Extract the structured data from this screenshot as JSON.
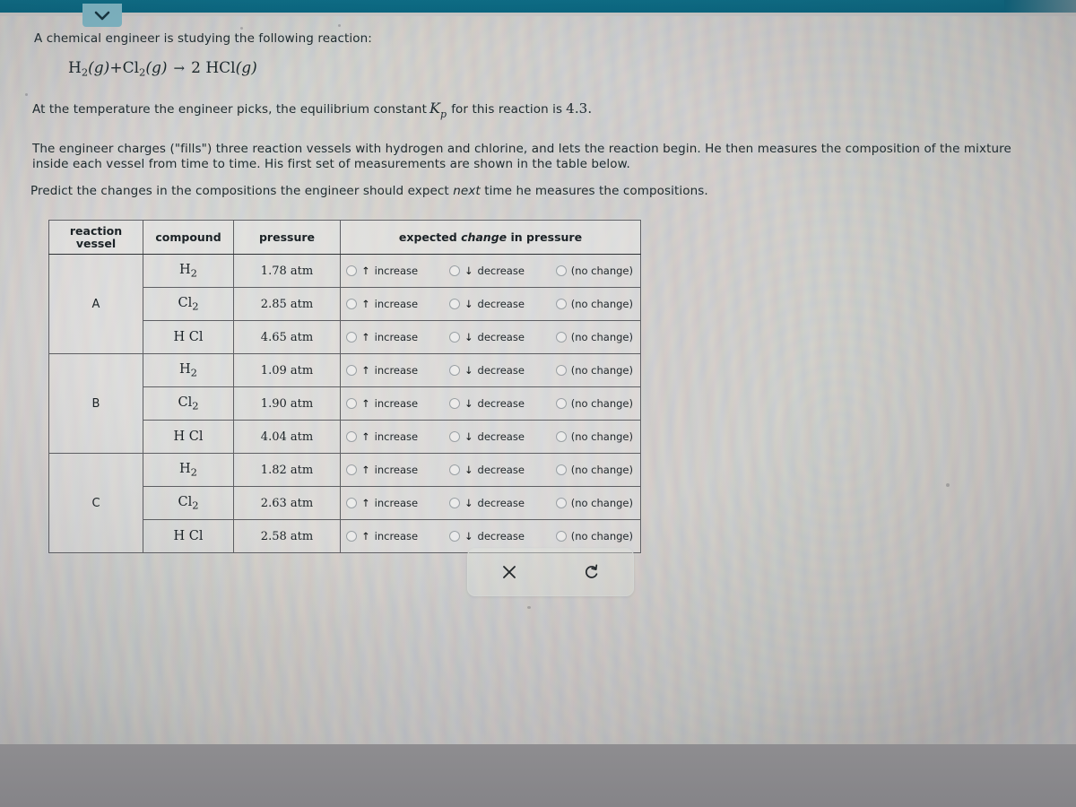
{
  "browser": {
    "tab_icon": "chevron-down-icon"
  },
  "problem": {
    "intro": "A chemical engineer is studying the following reaction:",
    "equation": {
      "reactant1": "H",
      "reactant1_sub": "2",
      "reactant1_state": "(g)",
      "plus": "+",
      "reactant2": "Cl",
      "reactant2_sub": "2",
      "reactant2_state": "(g)",
      "arrow": "→",
      "coefficient": "2",
      "product": "HCl",
      "product_state": "(g)",
      "full_text": "H2(g) + Cl2(g) → 2 HCl(g)"
    },
    "kp_sentence_before": "At the temperature the engineer picks, the equilibrium constant",
    "kp_symbol": "K",
    "kp_subscript": "p",
    "kp_sentence_after": "for this reaction is",
    "kp_value": "4.3",
    "kp_period": ".",
    "paragraph_line1": "The engineer charges (\"fills\") three reaction vessels with hydrogen and chlorine, and lets the reaction begin. He then measures the composition of the mixture",
    "paragraph_line2": "inside each vessel from time to time. His first set of measurements are shown in the table below.",
    "prompt_before": "Predict the changes in the compositions the engineer should expect",
    "prompt_emphasis": "next",
    "prompt_after": "time he measures the compositions."
  },
  "table": {
    "headers": {
      "vessel": "reaction vessel",
      "vessel_line1": "reaction",
      "vessel_line2": "vessel",
      "compound": "compound",
      "pressure": "pressure",
      "change_before": "expected",
      "change_emphasis": "change",
      "change_after": "in pressure"
    },
    "options": [
      {
        "id": "increase",
        "arrow": "↑",
        "label": "increase",
        "selected": false
      },
      {
        "id": "decrease",
        "arrow": "↓",
        "label": "decrease",
        "selected": false
      },
      {
        "id": "no-change",
        "arrow": "",
        "label": "(no change)",
        "selected": false
      }
    ],
    "groups": [
      {
        "vessel": "A",
        "rows": [
          {
            "compound": "H",
            "compound_sub": "2",
            "pressure": "1.78 atm"
          },
          {
            "compound": "Cl",
            "compound_sub": "2",
            "pressure": "2.85 atm"
          },
          {
            "compound": "H Cl",
            "compound_sub": "",
            "pressure": "4.65 atm"
          }
        ]
      },
      {
        "vessel": "B",
        "rows": [
          {
            "compound": "H",
            "compound_sub": "2",
            "pressure": "1.09 atm"
          },
          {
            "compound": "Cl",
            "compound_sub": "2",
            "pressure": "1.90 atm"
          },
          {
            "compound": "H Cl",
            "compound_sub": "",
            "pressure": "4.04 atm"
          }
        ]
      },
      {
        "vessel": "C",
        "rows": [
          {
            "compound": "H",
            "compound_sub": "2",
            "pressure": "1.82 atm"
          },
          {
            "compound": "Cl",
            "compound_sub": "2",
            "pressure": "2.63 atm"
          },
          {
            "compound": "H Cl",
            "compound_sub": "",
            "pressure": "2.58 atm"
          }
        ]
      }
    ]
  },
  "footer": {
    "clear_icon": "close-x-icon",
    "reset_icon": "undo-reset-icon"
  },
  "colors": {
    "browser_bar": "#0a6680",
    "tab_handle": "#7fb6c4",
    "text": "#1d2a2e",
    "table_border": "#5e5f63",
    "page_bg": "#cdcbc9",
    "bezel": "#8b8b8e"
  }
}
